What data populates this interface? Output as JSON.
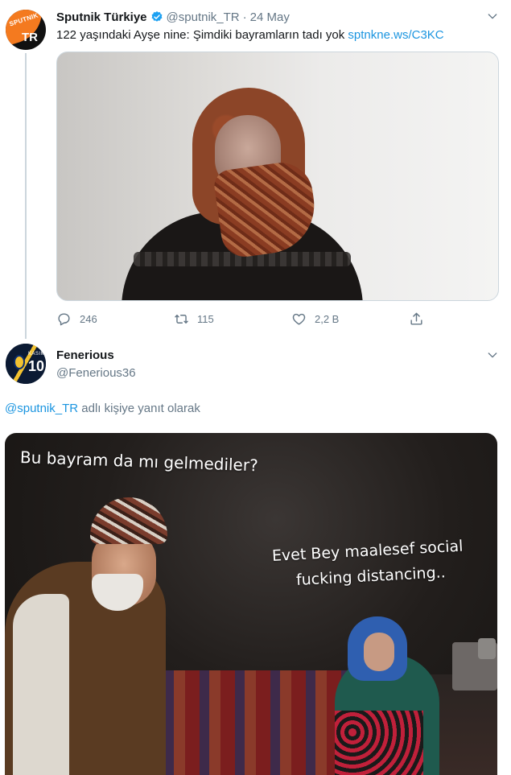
{
  "tweet1": {
    "avatar_text_top": "SPUTNIK",
    "avatar_text_bottom": "TR",
    "display_name": "Sputnik Türkiye",
    "handle": "@sputnik_TR",
    "separator": "·",
    "date": "24 May",
    "text": "122 yaşındaki Ayşe nine: Şimdiki bayramların tadı yok ",
    "link": "sptnkne.ws/C3KC",
    "actions": {
      "reply_count": "246",
      "retweet_count": "115",
      "like_count": "2,2 B"
    }
  },
  "tweet2": {
    "avatar_text_top": "KASIM",
    "avatar_text_number": "10",
    "display_name": "Fenerious",
    "handle": "@Fenerious36",
    "reply_to_handle": "@sputnik_TR",
    "reply_to_suffix": " adlı kişiye yanıt olarak",
    "image_caption_top": "Bu bayram da mı gelmediler?",
    "image_caption_line1": "Evet Bey maalesef social",
    "image_caption_line2": "fucking distancing.."
  },
  "colors": {
    "link": "#1b95e0",
    "muted": "#657786",
    "verified": "#1da1f2",
    "brand_orange": "#f47a1f"
  },
  "icons": [
    "verified-badge-icon",
    "chevron-down-icon",
    "reply-icon",
    "retweet-icon",
    "like-icon",
    "share-icon"
  ]
}
